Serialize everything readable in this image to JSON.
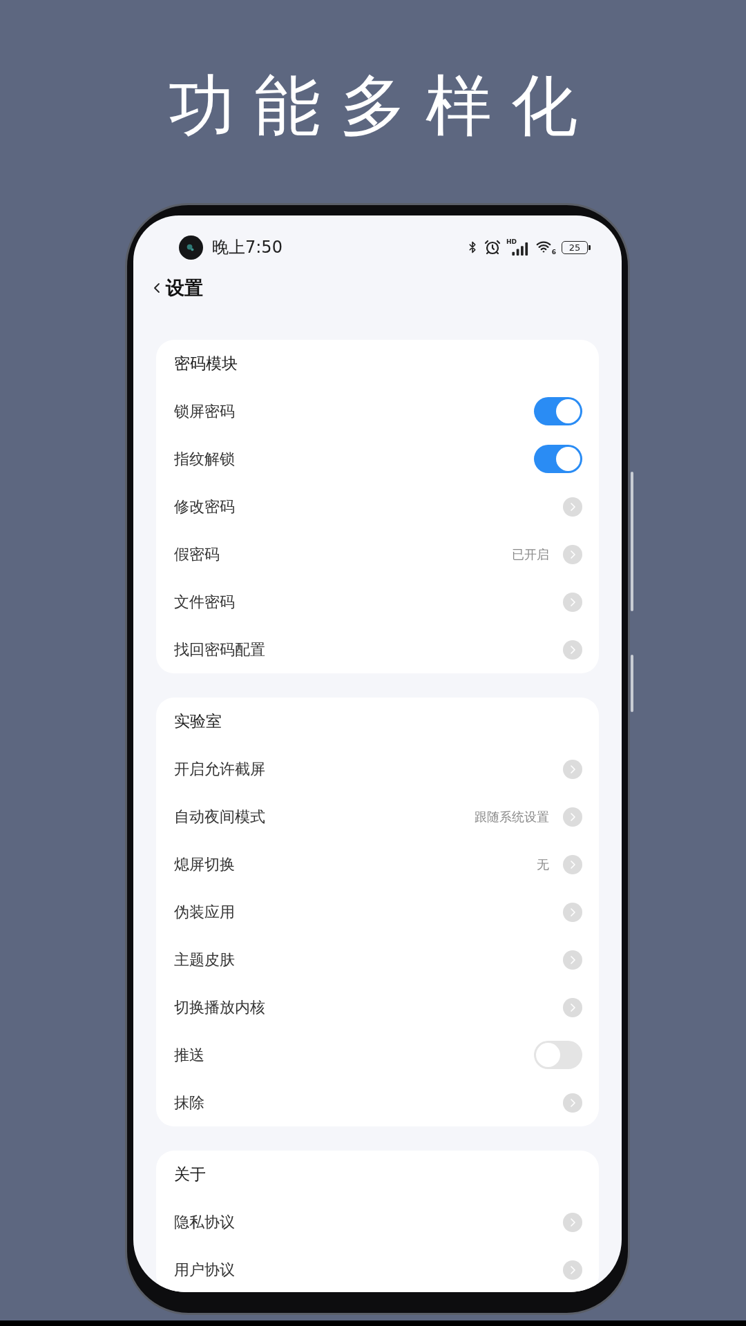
{
  "headline": "功能多样化",
  "status_bar": {
    "time": "晚上7:50",
    "signal_label": "HD",
    "wifi_label": "6",
    "battery": "25"
  },
  "nav": {
    "title": "设置"
  },
  "sections": [
    {
      "title": "密码模块",
      "rows": [
        {
          "label": "锁屏密码",
          "kind": "toggle",
          "on": true
        },
        {
          "label": "指纹解锁",
          "kind": "toggle",
          "on": true
        },
        {
          "label": "修改密码",
          "kind": "link"
        },
        {
          "label": "假密码",
          "kind": "link",
          "value": "已开启"
        },
        {
          "label": "文件密码",
          "kind": "link"
        },
        {
          "label": "找回密码配置",
          "kind": "link"
        }
      ]
    },
    {
      "title": "实验室",
      "rows": [
        {
          "label": "开启允许截屏",
          "kind": "link"
        },
        {
          "label": "自动夜间模式",
          "kind": "link",
          "value": "跟随系统设置"
        },
        {
          "label": "熄屏切换",
          "kind": "link",
          "value": "无"
        },
        {
          "label": "伪装应用",
          "kind": "link"
        },
        {
          "label": "主题皮肤",
          "kind": "link"
        },
        {
          "label": "切换播放内核",
          "kind": "link"
        },
        {
          "label": "推送",
          "kind": "toggle",
          "on": false
        },
        {
          "label": "抹除",
          "kind": "link"
        }
      ]
    },
    {
      "title": "关于",
      "rows": [
        {
          "label": "隐私协议",
          "kind": "link"
        },
        {
          "label": "用户协议",
          "kind": "link"
        }
      ]
    }
  ]
}
